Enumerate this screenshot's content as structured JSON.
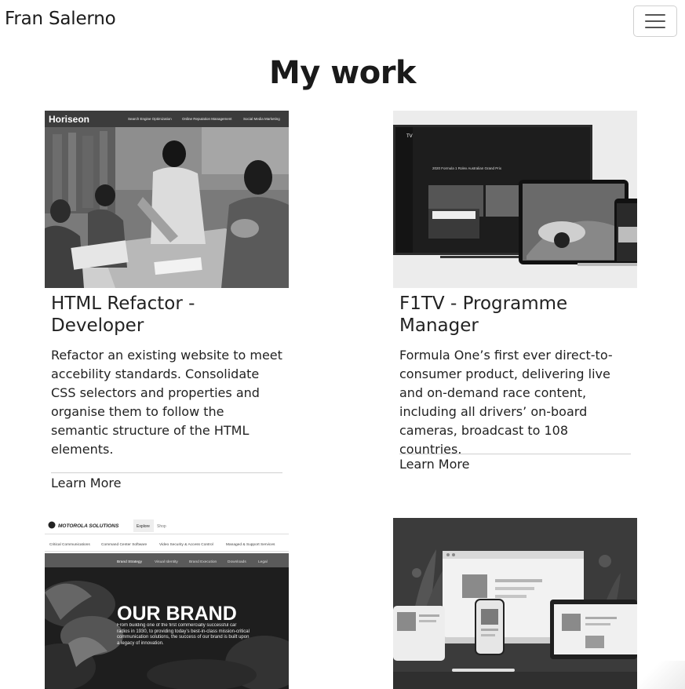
{
  "navbar": {
    "brand": "Fran Salerno",
    "toggle_icon": "hamburger-icon"
  },
  "heading": "My work",
  "cards": [
    {
      "title": "HTML Refactor - Developer",
      "title_line1": "HTML Refactor -",
      "title_line2": "Developer",
      "description": "Refactor an existing website to meet accebility standards. Consolidate CSS selectors and properties and organise them to follow the semantic structure of the HTML elements.",
      "link": "Learn More",
      "image": {
        "logo": "Horiseon",
        "nav": [
          "Search Engine Optimization",
          "Online Reputation Management",
          "Social Media Marketing"
        ]
      }
    },
    {
      "title": "F1TV - Programme Manager",
      "title_line1": "F1TV - Programme",
      "title_line2": "Manager",
      "description": "Formula One’s first ever direct-to-consumer product, delivering live and on-demand race content, including all drivers’ on-board cameras, broadcast to 108 countries.",
      "link": "Learn More",
      "image": {
        "logo": "TV",
        "headline": "2020 Formula 1 Rolex Australian Grand Prix"
      }
    },
    {
      "image": {
        "logo": "MOTOROLA SOLUTIONS",
        "tabs": [
          "Explore",
          "Shop"
        ],
        "nav": [
          "Critical Communications",
          "Command Center Software",
          "Video Security & Access Control",
          "Managed & Support Services"
        ],
        "subnav": [
          "Brand Strategy",
          "Visual Identity",
          "Brand Execution",
          "Downloads",
          "Legal"
        ],
        "headline": "OUR BRAND",
        "copy": "From building one of the first commercially successful car radios in 1930, to providing today’s best-in-class mission-critical communication solutions, the success of our brand is built upon a legacy of innovation."
      }
    },
    {
      "image": {
        "subject": "responsive-devices-illustration"
      }
    }
  ]
}
